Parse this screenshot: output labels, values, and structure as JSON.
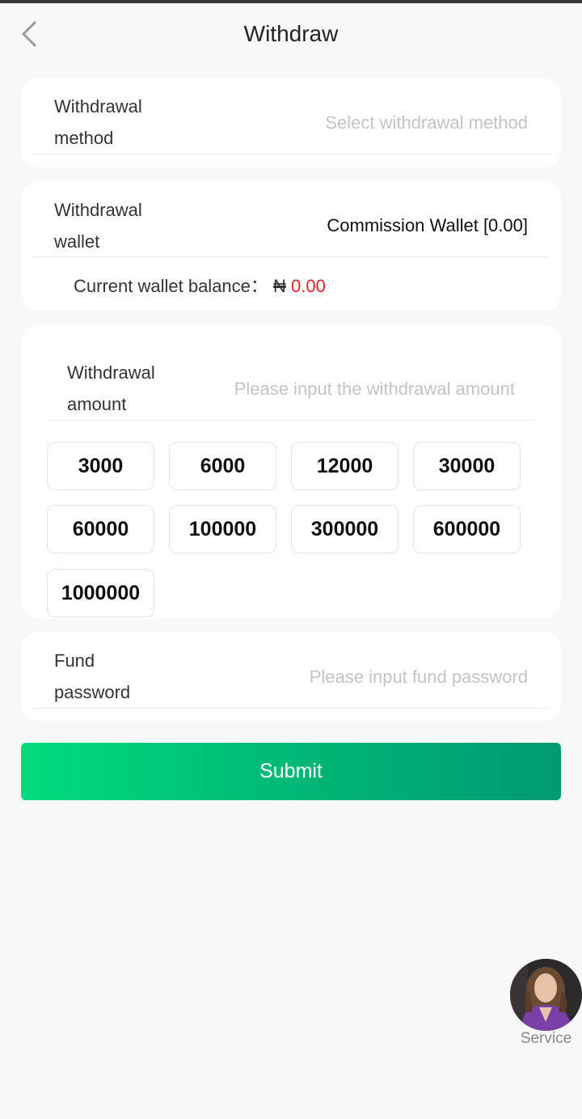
{
  "header": {
    "title": "Withdraw",
    "back_icon": "chevron-left-icon"
  },
  "method": {
    "label": "Withdrawal method",
    "placeholder": "Select withdrawal method"
  },
  "wallet": {
    "label": "Withdrawal wallet",
    "value": "Commission Wallet [0.00]",
    "balance_label": "Current wallet balance：",
    "currency": "₦",
    "balance": "0.00"
  },
  "amount": {
    "label": "Withdrawal amount",
    "placeholder": "Please input the withdrawal amount",
    "presets": [
      "3000",
      "6000",
      "12000",
      "30000",
      "60000",
      "100000",
      "300000",
      "600000",
      "1000000"
    ]
  },
  "fund_password": {
    "label": "Fund password",
    "placeholder": "Please input fund password"
  },
  "submit": {
    "label": "Submit"
  },
  "service": {
    "label": "Service"
  },
  "colors": {
    "accent_start": "#00db7d",
    "accent_end": "#009a72",
    "balance_red": "#e0232a",
    "placeholder": "#c4c4c4"
  }
}
